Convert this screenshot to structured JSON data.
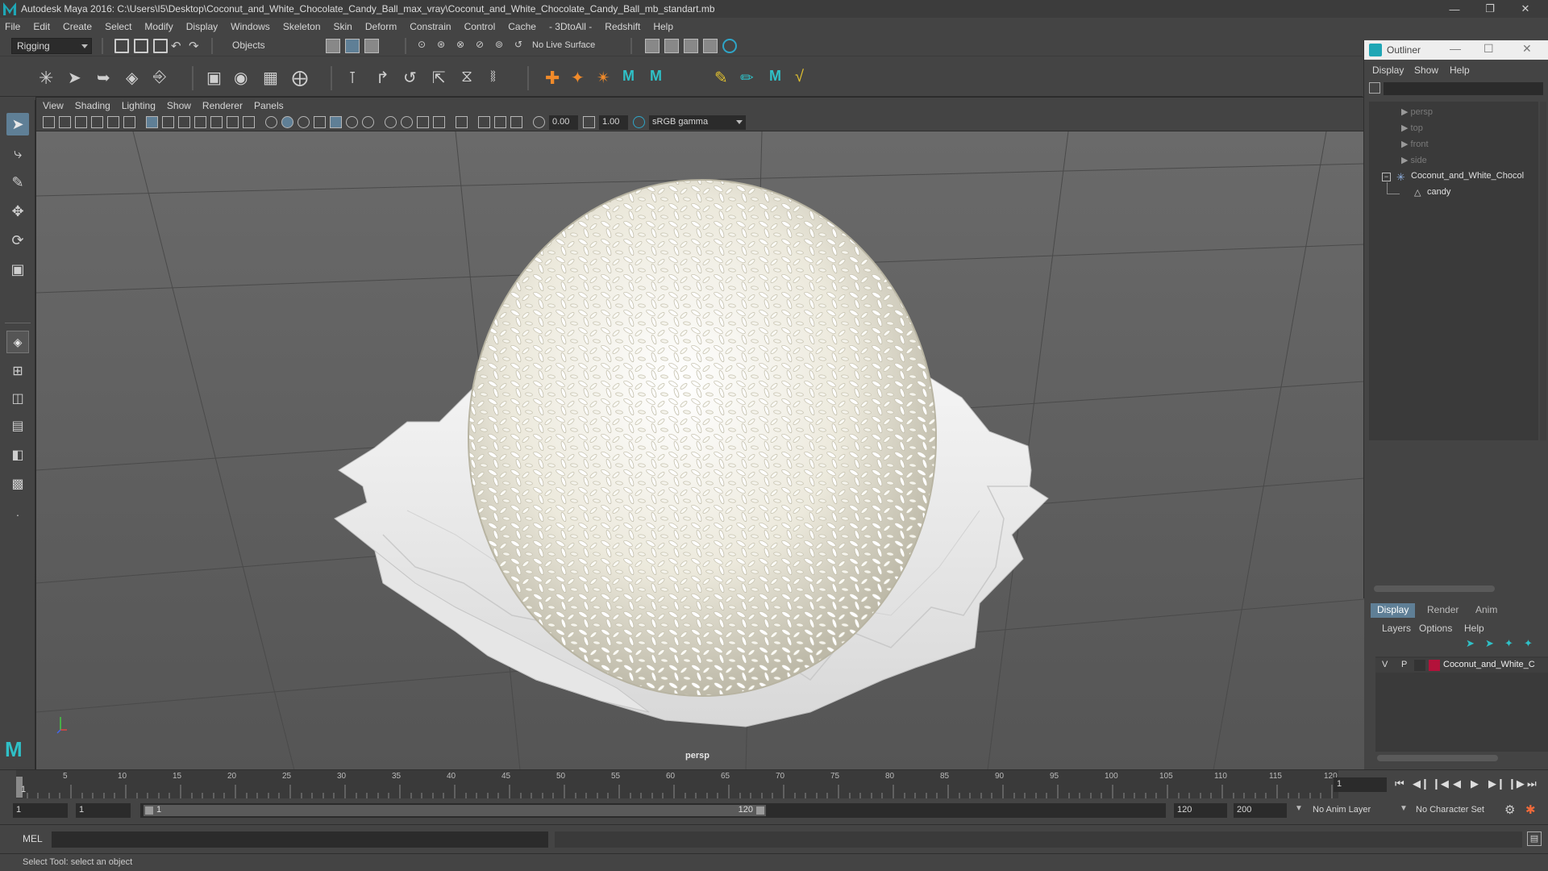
{
  "window": {
    "title": "Autodesk Maya 2016: C:\\Users\\I5\\Desktop\\Coconut_and_White_Chocolate_Candy_Ball_max_vray\\Coconut_and_White_Chocolate_Candy_Ball_mb_standart.mb"
  },
  "menubar": [
    "File",
    "Edit",
    "Create",
    "Select",
    "Modify",
    "Display",
    "Windows",
    "Skeleton",
    "Skin",
    "Deform",
    "Constrain",
    "Control",
    "Cache",
    "- 3DtoAll -",
    "Redshift",
    "Help"
  ],
  "statusline": {
    "mode": "Rigging",
    "selection_mask": "Objects",
    "live_surface": "No Live Surface"
  },
  "panel": {
    "menu": [
      "View",
      "Shading",
      "Lighting",
      "Show",
      "Renderer",
      "Panels"
    ],
    "exposure": "0.00",
    "gamma": "1.00",
    "color_space": "sRGB gamma",
    "camera_label": "persp"
  },
  "outliner": {
    "title": "Outliner",
    "menu": [
      "Display",
      "Show",
      "Help"
    ],
    "items": [
      {
        "label": "persp"
      },
      {
        "label": "top"
      },
      {
        "label": "front"
      },
      {
        "label": "side"
      },
      {
        "label": "Coconut_and_White_Chocol"
      },
      {
        "label": "candy"
      }
    ]
  },
  "layers": {
    "tabs": [
      "Display",
      "Render",
      "Anim"
    ],
    "menu": [
      "Layers",
      "Options",
      "Help"
    ],
    "row": {
      "v": "V",
      "p": "P",
      "name": "Coconut_and_White_C",
      "color": "#b3123a"
    }
  },
  "timeline": {
    "ticks": [
      "5",
      "10",
      "15",
      "20",
      "25",
      "30",
      "35",
      "40",
      "45",
      "50",
      "55",
      "60",
      "65",
      "70",
      "75",
      "80",
      "85",
      "90",
      "95",
      "100",
      "105",
      "110",
      "115",
      "120"
    ],
    "current_frame_label": "1",
    "current_frame": "1"
  },
  "range": {
    "start": "1",
    "playback_start": "1",
    "slider_start": "1",
    "slider_end": "120",
    "playback_end": "120",
    "end": "200",
    "anim_layer": "No Anim Layer",
    "character_set": "No Character Set"
  },
  "cmdline": {
    "label": "MEL"
  },
  "helpline": {
    "text": "Select Tool: select an object"
  }
}
